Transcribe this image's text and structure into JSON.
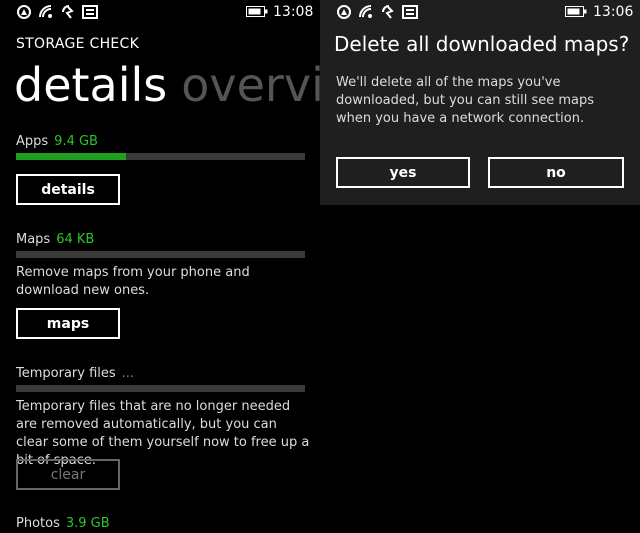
{
  "left_screen": {
    "status_bar": {
      "time": "13:08"
    },
    "app_title": "STORAGE CHECK",
    "pivot": {
      "active": "details",
      "inactive": "overview"
    },
    "sections": {
      "apps": {
        "label": "Apps",
        "value": "9.4 GB",
        "usage_fraction": 0.38,
        "button": "details"
      },
      "maps": {
        "label": "Maps",
        "value": "64 KB",
        "usage_fraction": 0.0,
        "description": "Remove maps from your phone and download new ones.",
        "button": "maps"
      },
      "temp": {
        "label": "Temporary files",
        "value": "...",
        "usage_fraction": 0.0,
        "description": "Temporary files that are no longer needed are removed automatically, but you can clear some of them yourself now to free up a bit of space.",
        "button": "clear"
      },
      "photos": {
        "label": "Photos",
        "value": "3.9 GB"
      }
    }
  },
  "right_screen": {
    "status_bar": {
      "time": "13:06"
    },
    "dialog": {
      "title": "Delete all downloaded maps?",
      "message": "We'll delete all of the maps you've downloaded, but you can still see maps when you have a network connection.",
      "yes": "yes",
      "no": "no"
    }
  },
  "colors": {
    "accent": "#1f9e1f",
    "value_text": "#2cc52c",
    "bar_track": "#3a3a3a",
    "dialog_bg": "#1f1f1f"
  }
}
